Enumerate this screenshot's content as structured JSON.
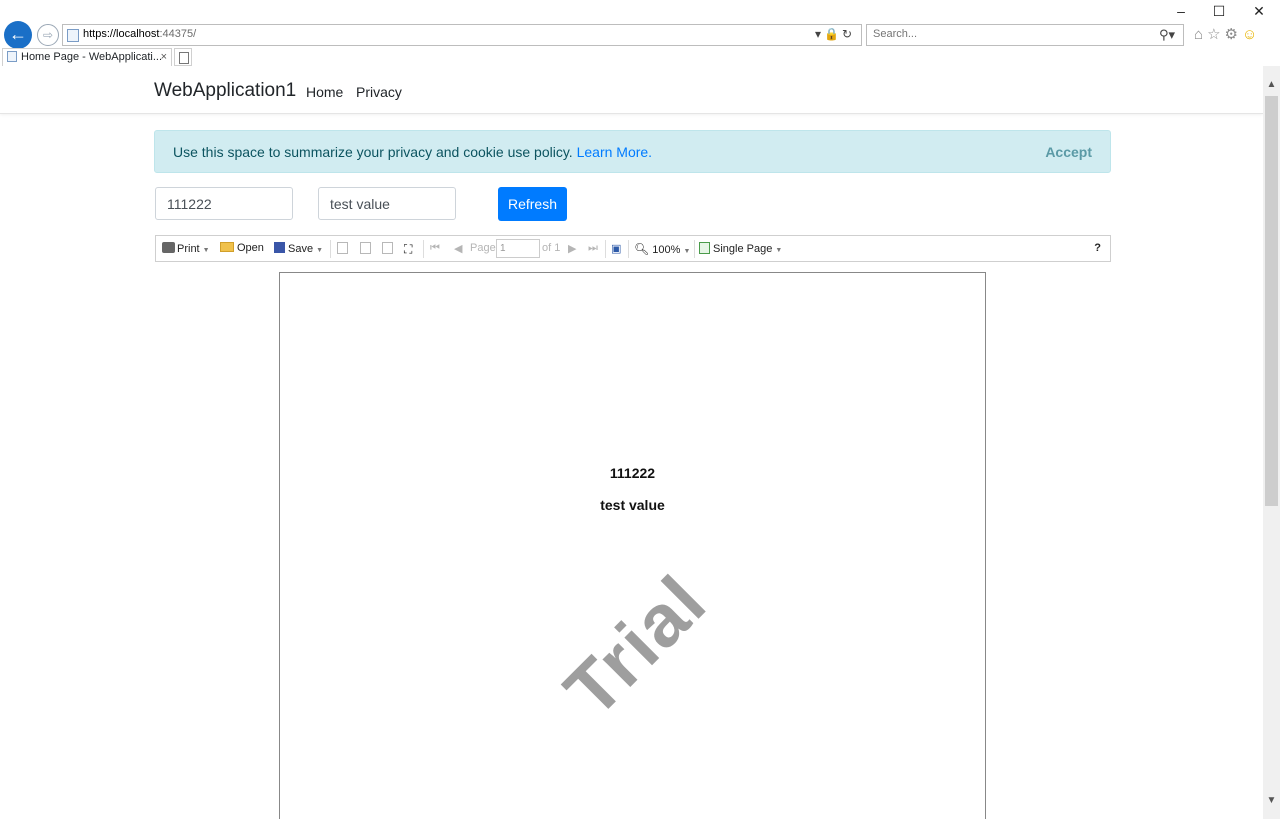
{
  "browser": {
    "window_controls": {
      "minimize": "–",
      "maximize": "☐",
      "close": "✕"
    },
    "address": {
      "scheme_host": "https://localhost",
      "port_path": ":44375/"
    },
    "search_placeholder": "Search...",
    "tab": {
      "title": "Home Page - WebApplicati...",
      "close": "×"
    },
    "icons": [
      "back-arrow-icon",
      "forward-arrow-icon",
      "lock-icon",
      "refresh-icon",
      "search-icon",
      "home-icon",
      "favorites-star-icon",
      "settings-gear-icon",
      "smiley-feedback-icon"
    ]
  },
  "navbar": {
    "brand": "WebApplication1",
    "links": [
      "Home",
      "Privacy"
    ]
  },
  "cookie_banner": {
    "text": "Use this space to summarize your privacy and cookie use policy.",
    "link": "Learn More.",
    "accept": "Accept",
    "colors": {
      "background": "#d1ecf1",
      "text": "#0c5460",
      "link": "#007bff"
    }
  },
  "form": {
    "field1_value": "111222",
    "field2_value": "test value",
    "refresh_label": "Refresh",
    "accent": "#007bff"
  },
  "report_toolbar": {
    "print": "Print",
    "open": "Open",
    "save": "Save",
    "page_label": "Page",
    "page_value": "1",
    "of_label": "of 1",
    "zoom": "100%",
    "view_mode": "Single Page",
    "help": "?"
  },
  "report": {
    "line1": "111222",
    "line2": "test value",
    "watermark": "Trial"
  }
}
